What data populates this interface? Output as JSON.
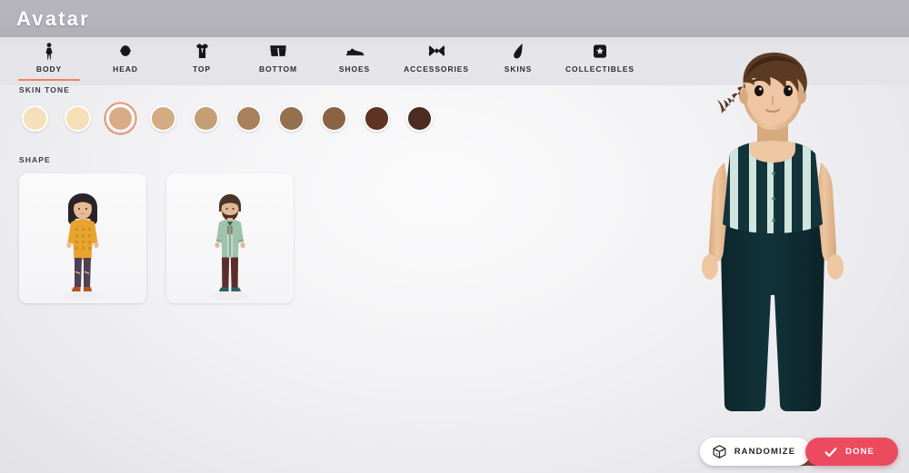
{
  "header": {
    "title": "Avatar"
  },
  "tabs": [
    {
      "label": "BODY",
      "icon": "body-icon",
      "active": true
    },
    {
      "label": "HEAD",
      "icon": "head-icon",
      "active": false
    },
    {
      "label": "TOP",
      "icon": "tshirt-icon",
      "active": false
    },
    {
      "label": "BOTTOM",
      "icon": "shorts-icon",
      "active": false
    },
    {
      "label": "SHOES",
      "icon": "shoe-icon",
      "active": false
    },
    {
      "label": "ACCESSORIES",
      "icon": "bow-icon",
      "active": false
    },
    {
      "label": "SKINS",
      "icon": "skin-icon",
      "active": false
    },
    {
      "label": "COLLECTIBLES",
      "icon": "collectible-icon",
      "active": false
    }
  ],
  "skin_tone": {
    "label": "SKIN TONE",
    "selected_index": 2,
    "swatches": [
      {
        "color": "#f6dfbb"
      },
      {
        "color": "#f7deb4"
      },
      {
        "color": "#d9ab87"
      },
      {
        "color": "#d4ac83"
      },
      {
        "color": "#c39f77"
      },
      {
        "color": "#a8805c"
      },
      {
        "color": "#93714f"
      },
      {
        "color": "#8a6345"
      },
      {
        "color": "#5d3323"
      },
      {
        "color": "#4b2c1e"
      }
    ]
  },
  "shape": {
    "label": "SHAPE",
    "options": [
      {
        "name": "feminine-shape",
        "hair": "#2b2328",
        "skin": "#e8bb97",
        "top": "#e8a52e",
        "top_shadow": "#d18e1f",
        "pants": "#4e4156",
        "shoes": "#b1551f",
        "selected": false
      },
      {
        "name": "masculine-shape",
        "hair": "#4a3328",
        "skin": "#e0b894",
        "top": "#9ec3ad",
        "top_shadow": "#86ad95",
        "pants": "#5b2e2c",
        "shoes": "#2f5f63",
        "selected": false
      }
    ]
  },
  "avatar_preview": {
    "name": "avatar-3d-preview",
    "hair": "#5b3a24",
    "hair_dark": "#422716",
    "skin": "#eec6a1",
    "skin_shadow": "#d7a97f",
    "top_dark": "#13343a",
    "top_stripe": "#cfe5de",
    "pants": "#12333a",
    "sandals": "#6b4a32"
  },
  "actions": {
    "randomize": {
      "label": "RANDOMIZE",
      "icon": "dice-icon",
      "color": "#ffffff"
    },
    "done": {
      "label": "DONE",
      "icon": "check-icon",
      "color": "#ec4b5f"
    }
  },
  "theme": {
    "accent": "#ef8350",
    "selected_ring": "#e8643c",
    "header_bg": "#b4b2ba",
    "tabbar_bg": "#e5e5ea"
  }
}
